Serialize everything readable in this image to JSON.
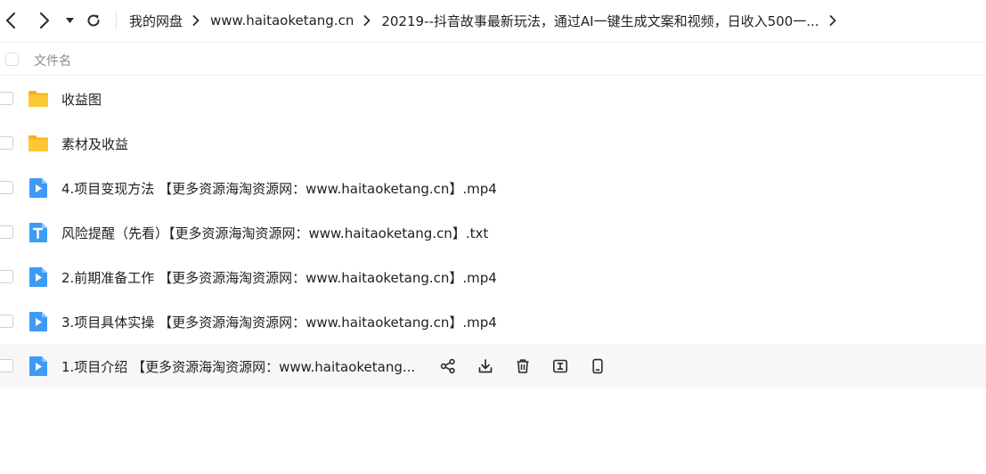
{
  "nav": {
    "back_icon": "chevron-left-icon",
    "forward_icon": "chevron-right-icon",
    "history_icon": "caret-down-icon",
    "refresh_icon": "refresh-icon"
  },
  "breadcrumb": [
    {
      "label": "我的网盘"
    },
    {
      "label": "www.haitaoketang.cn"
    },
    {
      "label": "20219--抖音故事最新玩法，通过AI一键生成文案和视频，日收入500一..."
    }
  ],
  "list_header": {
    "name_label": "文件名"
  },
  "files": [
    {
      "name": "收益图",
      "icon": "folder-icon"
    },
    {
      "name": "素材及收益",
      "icon": "folder-icon"
    },
    {
      "name": "4.项目变现方法 【更多资源海淘资源网：www.haitaoketang.cn】.mp4",
      "icon": "video-file-icon"
    },
    {
      "name": "风险提醒（先看）【更多资源海淘资源网：www.haitaoketang.cn】.txt",
      "icon": "text-file-icon"
    },
    {
      "name": "2.前期准备工作 【更多资源海淘资源网：www.haitaoketang.cn】.mp4",
      "icon": "video-file-icon"
    },
    {
      "name": "3.项目具体实操 【更多资源海淘资源网：www.haitaoketang.cn】.mp4",
      "icon": "video-file-icon"
    },
    {
      "name": "1.项目介绍 【更多资源海淘资源网：www.haitaoketang...",
      "icon": "video-file-icon"
    }
  ],
  "row_actions": [
    {
      "icon": "share-icon"
    },
    {
      "icon": "download-icon"
    },
    {
      "icon": "trash-icon"
    },
    {
      "icon": "rename-icon"
    },
    {
      "icon": "mobile-icon"
    }
  ],
  "colors": {
    "folder": "#fbc02d",
    "video": "#3e9bf5",
    "text_file": "#3e9bf5",
    "hover_row": "#f7f7f9"
  }
}
